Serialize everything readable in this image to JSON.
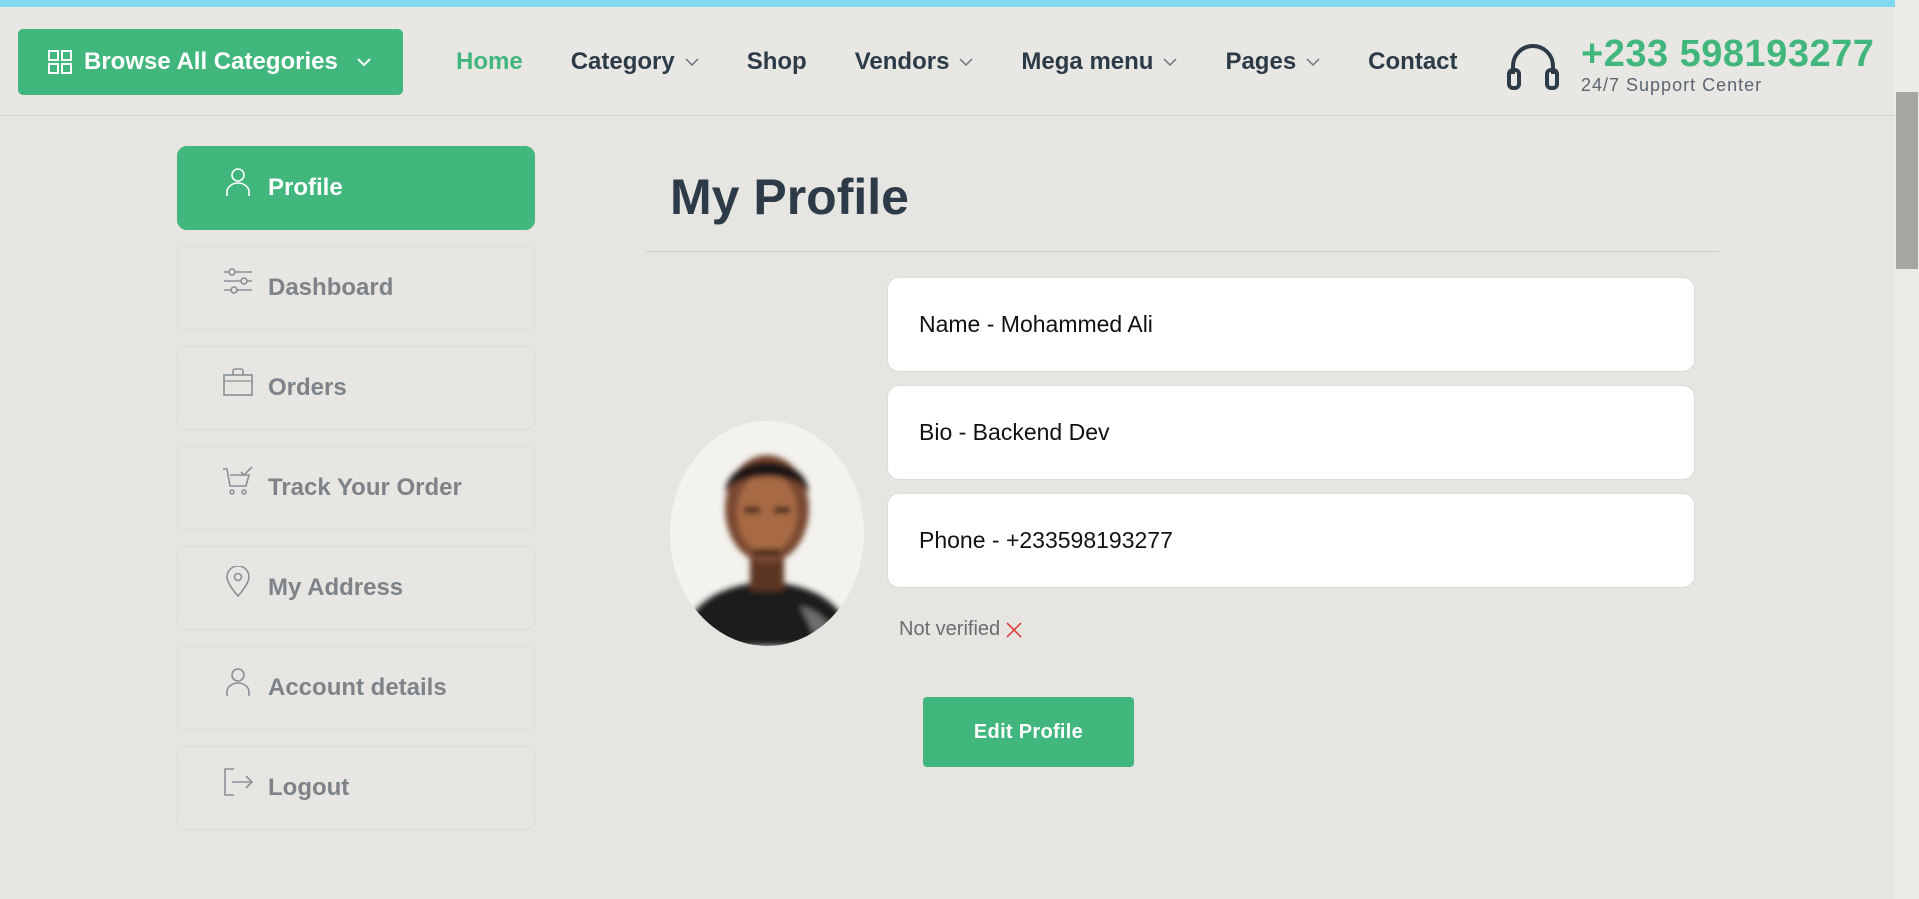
{
  "header": {
    "browse_label": "Browse  All Categories",
    "nav": [
      {
        "label": "Home",
        "active": true,
        "dropdown": false
      },
      {
        "label": "Category",
        "active": false,
        "dropdown": true
      },
      {
        "label": "Shop",
        "active": false,
        "dropdown": false
      },
      {
        "label": "Vendors",
        "active": false,
        "dropdown": true
      },
      {
        "label": "Mega menu",
        "active": false,
        "dropdown": true
      },
      {
        "label": "Pages",
        "active": false,
        "dropdown": true
      },
      {
        "label": "Contact",
        "active": false,
        "dropdown": false
      }
    ],
    "support_phone": "+233 598193277",
    "support_label": "24/7 Support Center"
  },
  "sidebar": {
    "items": [
      {
        "label": "Profile",
        "icon": "user-icon",
        "active": true
      },
      {
        "label": "Dashboard",
        "icon": "sliders-icon",
        "active": false
      },
      {
        "label": "Orders",
        "icon": "shopping-bag-icon",
        "active": false
      },
      {
        "label": "Track Your Order",
        "icon": "cart-check-icon",
        "active": false
      },
      {
        "label": "My Address",
        "icon": "location-pin-icon",
        "active": false
      },
      {
        "label": "Account details",
        "icon": "user-icon",
        "active": false
      },
      {
        "label": "Logout",
        "icon": "logout-icon",
        "active": false
      }
    ]
  },
  "profile": {
    "title": "My Profile",
    "name": "Name - Mohammed Ali",
    "bio": "Bio - Backend Dev",
    "phone": "Phone - +233598193277",
    "verification": "Not verified",
    "edit_label": "Edit Profile"
  },
  "colors": {
    "accent": "#41b67d",
    "text_dark": "#2d3b48",
    "unverified": "#e0403a"
  }
}
